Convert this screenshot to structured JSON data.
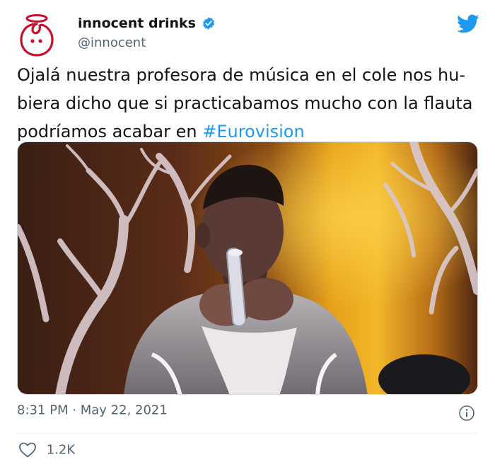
{
  "author": {
    "display_name": "innocent drinks",
    "handle": "@innocent",
    "avatar_icon": "innocent-logo-icon",
    "verified_icon": "verified-badge-icon"
  },
  "platform_icon": "twitter-bird-icon",
  "tweet": {
    "text_before": "Ojalá nuestra profesora de música en el cole nos hu-biera dicho que si practicabamos mucho con la flauta podríamos acabar en ",
    "hashtag": "#Eurovision"
  },
  "media": {
    "kind": "photo"
  },
  "meta": {
    "time": "8:31 PM",
    "separator": "·",
    "date": "May 22, 2021",
    "info_icon": "info-icon"
  },
  "engagement": {
    "like_icon": "heart-icon",
    "likes": "1.2K"
  },
  "colors": {
    "link": "#1d9bf0",
    "secondary_text": "#536471",
    "brand_red": "#c8102e",
    "twitter_blue": "#1d9bf0"
  }
}
